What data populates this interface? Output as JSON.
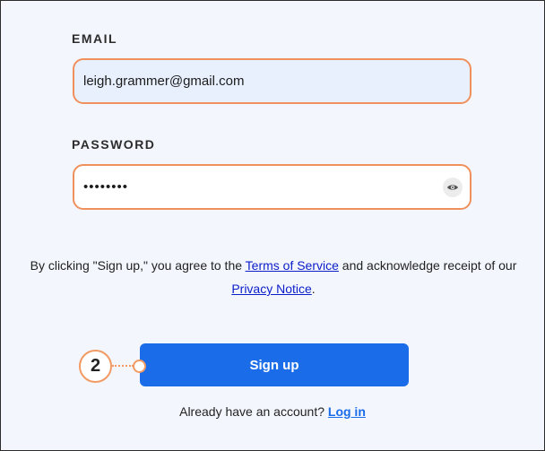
{
  "form": {
    "email_label": "EMAIL",
    "email_value": "leigh.grammer@gmail.com",
    "password_label": "PASSWORD",
    "password_value": "••••••••",
    "show_password_icon": "eye-icon"
  },
  "agreement": {
    "prefix": "By clicking \"Sign up,\" you agree to the ",
    "terms_link": "Terms of Service",
    "middle": " and acknowledge receipt of our",
    "privacy_link": "Privacy Notice",
    "suffix": "."
  },
  "signup_button": {
    "label": "Sign up"
  },
  "step_callout": {
    "number": "2"
  },
  "login": {
    "prompt": "Already have an account?",
    "link": "Log in"
  },
  "colors": {
    "accent": "#1a6ce8",
    "field_border": "#f0905c",
    "callout": "#f39a63",
    "background": "#f3f6fd"
  }
}
